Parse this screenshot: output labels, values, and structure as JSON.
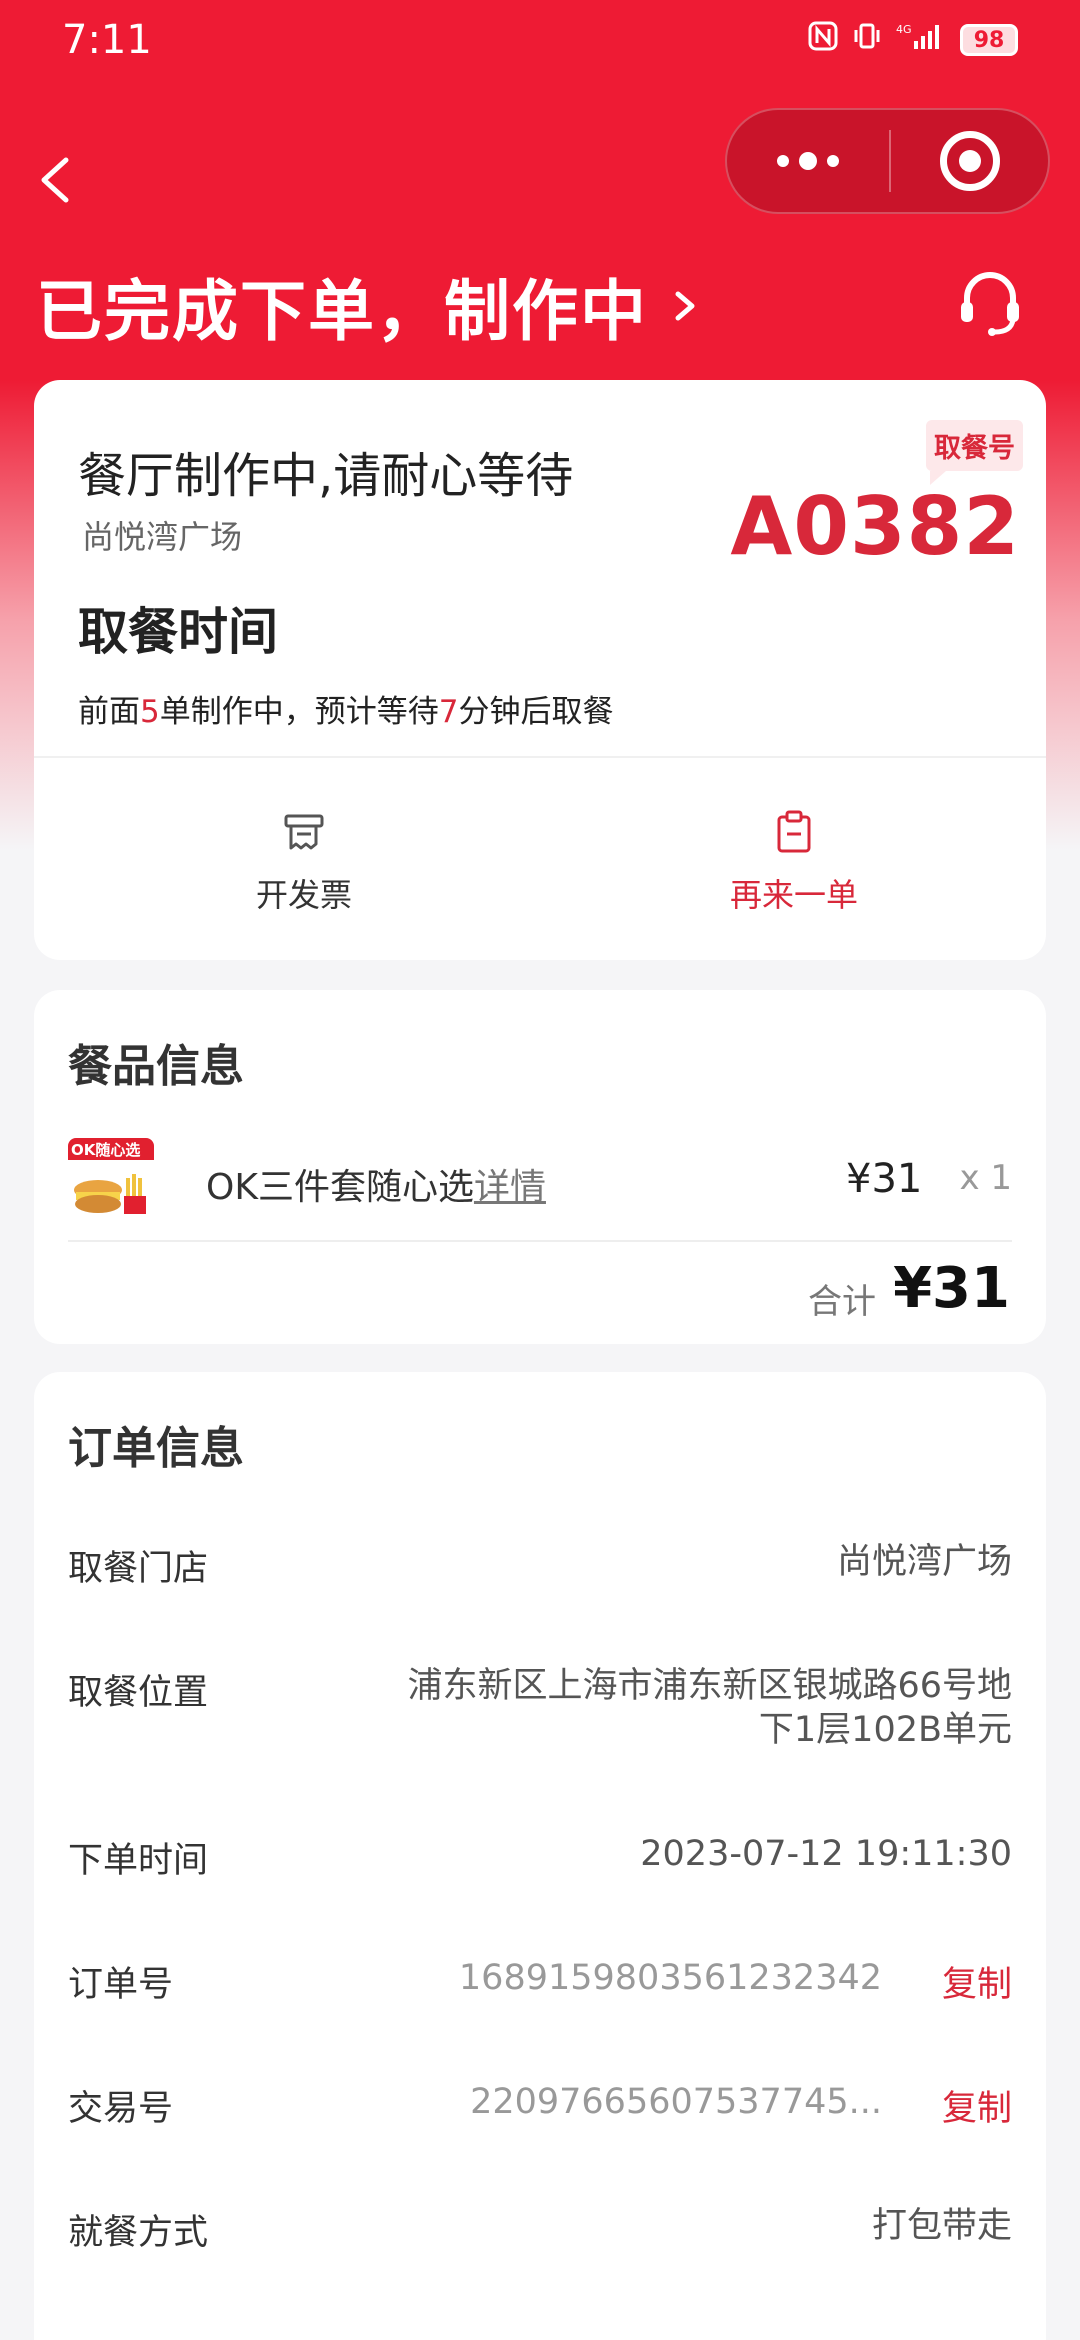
{
  "status_bar": {
    "time": "7:11",
    "icons": [
      "nfc-icon",
      "vibrate-icon",
      "4g-signal-icon",
      "battery-icon"
    ],
    "network_label": "4G",
    "battery": "98"
  },
  "nav": {
    "back_icon": "chevron-left-icon",
    "more_icon": "more-dots-icon",
    "close_icon": "target-close-icon"
  },
  "header": {
    "title": "已完成下单，制作中",
    "arrow_icon": "chevron-right-icon",
    "service_icon": "headset-icon"
  },
  "status_card": {
    "headline": "餐厅制作中,请耐心等待",
    "store": "尚悦湾广场",
    "pickup_badge": "取餐号",
    "pickup_number": "A0382",
    "time_title": "取餐时间",
    "wait_prefix": "前面",
    "wait_orders": "5",
    "wait_middle": "单制作中，预计等待",
    "wait_minutes": "7",
    "wait_suffix": "分钟后取餐",
    "actions": [
      {
        "label": "开发票",
        "icon": "receipt-icon"
      },
      {
        "label": "再来一单",
        "icon": "clipboard-icon"
      }
    ]
  },
  "items_card": {
    "title": "餐品信息",
    "items": [
      {
        "name": "OK三件套随心选",
        "detail_link": "详情",
        "price": "¥31",
        "qty": "x 1",
        "thumb_text": "OK随心选"
      }
    ],
    "total_label": "合计",
    "total_value": "¥31"
  },
  "order_card": {
    "title": "订单信息",
    "rows": [
      {
        "key": "取餐门店",
        "value": "尚悦湾广场"
      },
      {
        "key": "取餐位置",
        "value_line1": "浦东新区上海市浦东新区银城路66号地",
        "value_line2": "下1层102B单元"
      },
      {
        "key": "下单时间",
        "value": "2023-07-12 19:11:30"
      },
      {
        "key": "订单号",
        "value": "1689159803561232342",
        "action": "复制"
      },
      {
        "key": "交易号",
        "value": "22097665607537745...",
        "action": "复制"
      },
      {
        "key": "就餐方式",
        "value": "打包带走"
      }
    ]
  },
  "colors": {
    "brand_red": "#ee1b34",
    "accent_red": "#d8283a",
    "background": "#f5f5f7"
  }
}
